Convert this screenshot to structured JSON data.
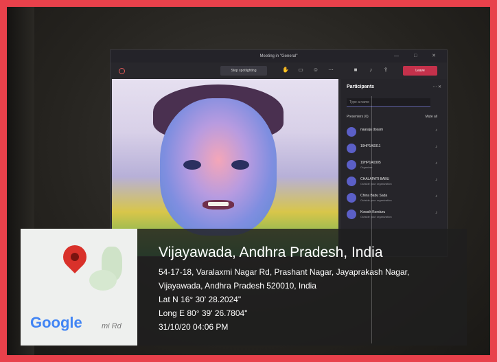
{
  "window": {
    "title": "Meeting in \"General\"",
    "controls": "— □ ✕"
  },
  "toolbar": {
    "stop_spotlighting": "Stop spotlighting",
    "leave": "Leave"
  },
  "participants_panel": {
    "title": "Participants",
    "search_placeholder": "Type a name",
    "section": "Presenters (6)",
    "mute_all": "Mute all",
    "people": [
      {
        "name": "naaraja dosam",
        "role": ""
      },
      {
        "name": "19HP1A0311",
        "role": ""
      },
      {
        "name": "19HP1A0305",
        "role": "Organizer"
      },
      {
        "name": "CHALAPATI BABU",
        "role": "Outside your organization"
      },
      {
        "name": "China Babu Sada",
        "role": "Outside your organization"
      },
      {
        "name": "Kowsik Konduru",
        "role": "Outside your organization"
      }
    ]
  },
  "geotag": {
    "location": "Vijayawada, Andhra Pradesh, India",
    "address": "54-17-18, Varalaxmi Nagar Rd, Prashant Nagar, Jayaprakash Nagar, Vijayawada, Andhra Pradesh 520010, India",
    "lat": "Lat N 16° 30' 28.2024\"",
    "long": "Long E 80° 39' 26.7804\"",
    "timestamp": "31/10/20 04:06 PM",
    "map_brand": "Google",
    "map_road": "mi Rd"
  },
  "colors": {
    "frame": "#e8414b",
    "leave": "#c4314b",
    "pin": "#d9312a"
  }
}
